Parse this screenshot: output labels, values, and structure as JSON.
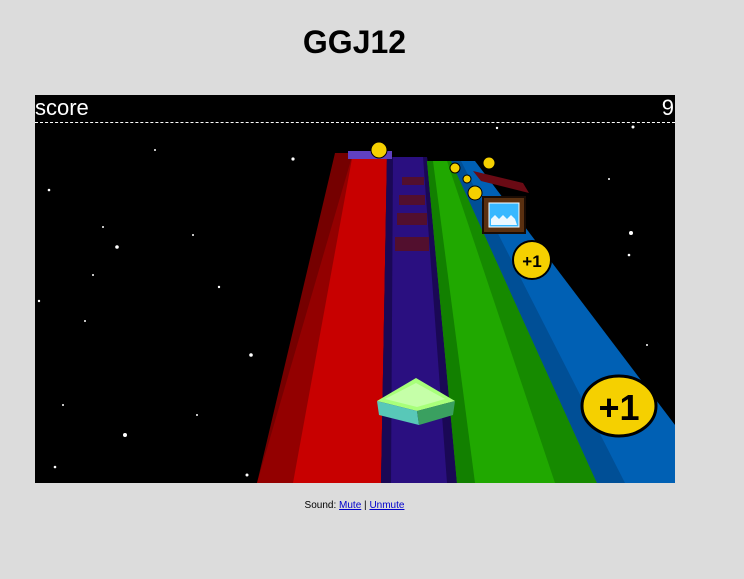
{
  "page": {
    "title": "GGJ12"
  },
  "hud": {
    "score_label": "score",
    "score_value": "9"
  },
  "pickups": {
    "near_label": "+1",
    "mid_label": "+1"
  },
  "sound": {
    "prefix": "Sound:",
    "mute_label": "Mute",
    "separator": "|",
    "unmute_label": "Unmute"
  },
  "colors": {
    "background": "#dcdcdc",
    "game_bg": "#000000",
    "lane_red": "#d40000",
    "lane_purple": "#2a0f80",
    "lane_green": "#1ea800",
    "lane_blue": "#0060b4",
    "coin": "#f5d000",
    "link": "#0000cc"
  }
}
